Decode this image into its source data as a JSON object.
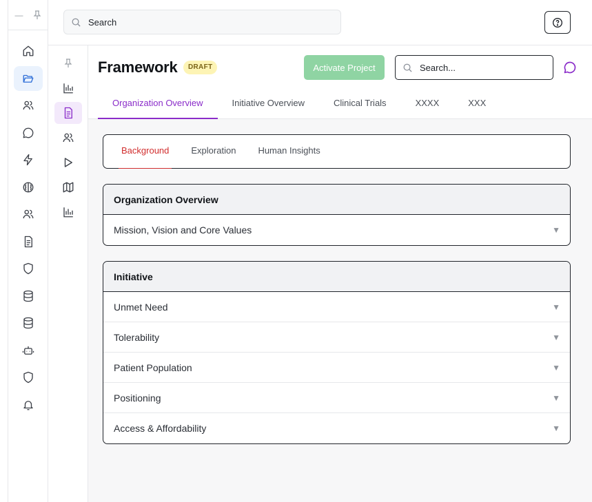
{
  "window": {
    "minimize_glyph": "—",
    "pin_icon": "pin-icon"
  },
  "rail": {
    "items": [
      {
        "icon": "home-icon"
      },
      {
        "icon": "folder-open-icon",
        "active": true
      },
      {
        "icon": "users-icon"
      },
      {
        "icon": "chat-icon"
      },
      {
        "icon": "lightning-icon"
      },
      {
        "icon": "brain-icon"
      },
      {
        "icon": "users-icon"
      },
      {
        "icon": "document-icon"
      },
      {
        "icon": "shield-icon"
      },
      {
        "icon": "database-icon"
      },
      {
        "icon": "database-icon"
      },
      {
        "icon": "bot-icon"
      },
      {
        "icon": "shield-icon"
      },
      {
        "icon": "bell-icon"
      }
    ]
  },
  "topbar": {
    "search_placeholder": "Search",
    "help_icon": "help-icon"
  },
  "subnav": {
    "items": [
      {
        "icon": "pin-icon"
      },
      {
        "icon": "bar-chart-icon"
      },
      {
        "icon": "document-icon",
        "active": true
      },
      {
        "icon": "users-icon"
      },
      {
        "icon": "play-icon"
      },
      {
        "icon": "map-icon"
      },
      {
        "icon": "bar-chart-icon"
      }
    ]
  },
  "header": {
    "title": "Framework",
    "badge": "DRAFT",
    "activate_label": "Activate Project",
    "search_placeholder": "Search...",
    "chat_icon": "chat-icon"
  },
  "tabs": [
    {
      "label": "Organization Overview",
      "active": true
    },
    {
      "label": "Initiative Overview"
    },
    {
      "label": "Clinical Trials"
    },
    {
      "label": "XXXX"
    },
    {
      "label": "XXX"
    }
  ],
  "subtabs": [
    {
      "label": "Background",
      "active": true
    },
    {
      "label": "Exploration"
    },
    {
      "label": "Human Insights"
    }
  ],
  "sections": [
    {
      "title": "Organization Overview",
      "rows": [
        "Mission, Vision and Core Values"
      ]
    },
    {
      "title": "Initiative",
      "rows": [
        "Unmet Need",
        "Tolerability",
        "Patient Population",
        "Positioning",
        "Access & Affordability"
      ]
    }
  ],
  "chevron_glyph": "▼",
  "colors": {
    "accent": "#8a2cc9",
    "rail_active": "#2f6fd8",
    "subtab_active": "#d12d2d",
    "activate": "#8fd4a3",
    "badge_bg": "#fdf4b5"
  }
}
